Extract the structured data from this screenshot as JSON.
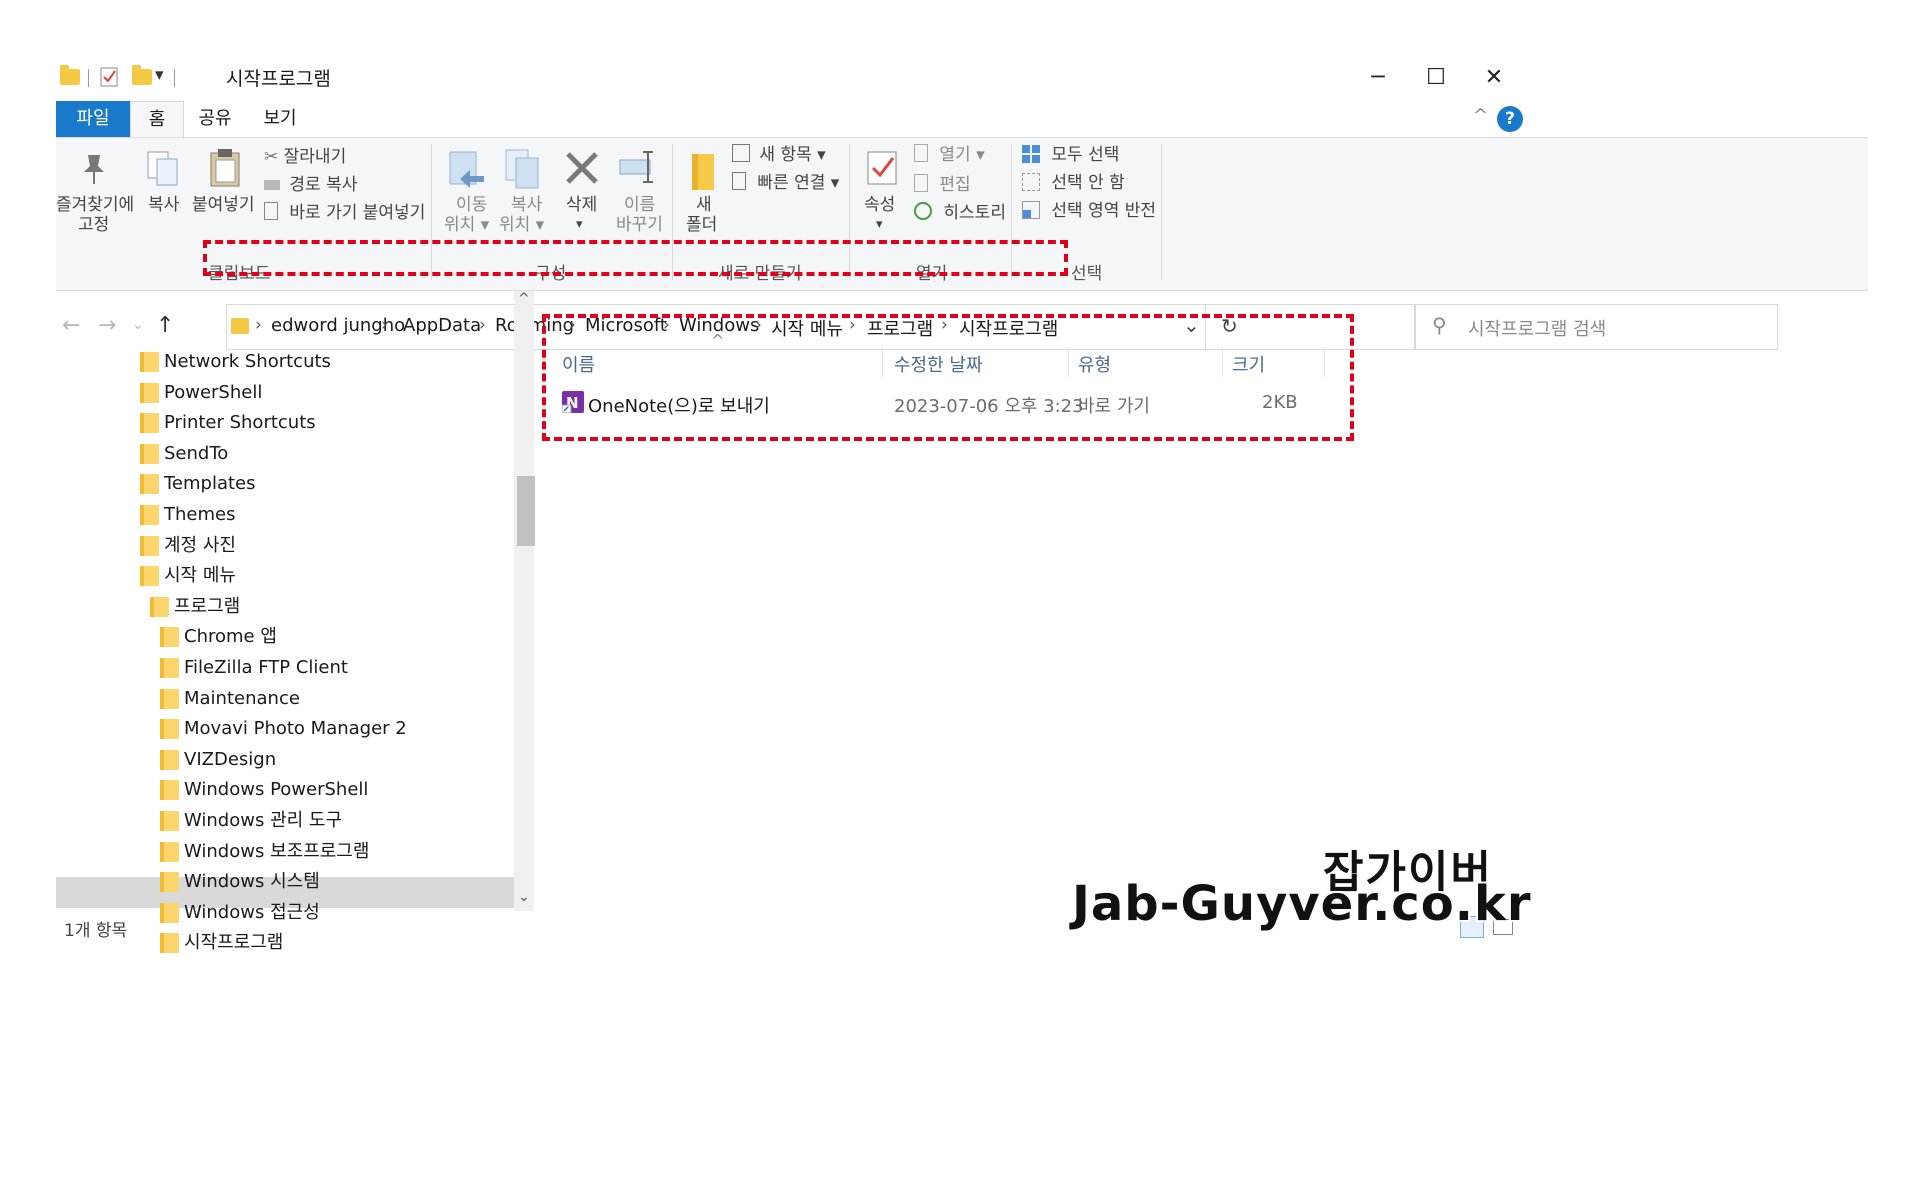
{
  "window": {
    "title": "시작프로그램",
    "controls": {
      "minimize": "─",
      "maximize": "☐",
      "close": "✕"
    }
  },
  "tabs": [
    {
      "label": "파일"
    },
    {
      "label": "홈"
    },
    {
      "label": "공유"
    },
    {
      "label": "보기"
    }
  ],
  "ribbon": {
    "clipboard": {
      "group": "클립보드",
      "pin_line1": "즐겨찾기에",
      "pin_line2": "고정",
      "copy": "복사",
      "paste": "붙여넣기",
      "cut": "잘라내기",
      "copy_path": "경로 복사",
      "paste_shortcut": "바로 가기 붙여넣기"
    },
    "organize": {
      "group": "구성",
      "move_line1": "이동",
      "move_line2": "위치 ▾",
      "copyto_line1": "복사",
      "copyto_line2": "위치 ▾",
      "delete": "삭제",
      "delete_arrow": "▾",
      "rename_line1": "이름",
      "rename_line2": "바꾸기"
    },
    "new": {
      "group": "새로 만들기",
      "new_folder_line1": "새",
      "new_folder_line2": "폴더",
      "new_item": "새 항목 ▾",
      "easy_access": "빠른 연결 ▾"
    },
    "open": {
      "group": "열기",
      "properties": "속성",
      "properties_arrow": "▾",
      "open": "열기 ▾",
      "edit": "편집",
      "history": "히스토리"
    },
    "select": {
      "group": "선택",
      "select_all": "모두 선택",
      "select_none": "선택 안 함",
      "invert": "선택 영역 반전"
    }
  },
  "address": {
    "breadcrumb": [
      "edword jungho",
      "AppData",
      "Roaming",
      "Microsoft",
      "Windows",
      "시작 메뉴",
      "프로그램",
      "시작프로그램"
    ],
    "search_placeholder": "시작프로그램 검색"
  },
  "tree": {
    "items": [
      {
        "label": "Network Shortcuts",
        "indent": 0
      },
      {
        "label": "PowerShell",
        "indent": 0
      },
      {
        "label": "Printer Shortcuts",
        "indent": 0
      },
      {
        "label": "SendTo",
        "indent": 0
      },
      {
        "label": "Templates",
        "indent": 0
      },
      {
        "label": "Themes",
        "indent": 0
      },
      {
        "label": "계정 사진",
        "indent": 0
      },
      {
        "label": "시작 메뉴",
        "indent": 0
      },
      {
        "label": "프로그램",
        "indent": 1
      },
      {
        "label": "Chrome 앱",
        "indent": 2
      },
      {
        "label": "FileZilla FTP Client",
        "indent": 2
      },
      {
        "label": "Maintenance",
        "indent": 2
      },
      {
        "label": "Movavi Photo Manager 2",
        "indent": 2
      },
      {
        "label": "VIZDesign",
        "indent": 2
      },
      {
        "label": "Windows PowerShell",
        "indent": 2
      },
      {
        "label": "Windows 관리 도구",
        "indent": 2
      },
      {
        "label": "Windows 보조프로그램",
        "indent": 2
      },
      {
        "label": "Windows 시스템",
        "indent": 2
      },
      {
        "label": "Windows 접근성",
        "indent": 2
      },
      {
        "label": "시작프로그램",
        "indent": 2
      }
    ]
  },
  "list": {
    "columns": {
      "name": "이름",
      "date": "수정한 날짜",
      "type": "유형",
      "size": "크기"
    },
    "rows": [
      {
        "name": "OneNote(으)로 보내기",
        "date": "2023-07-06 오후 3:23",
        "type": "바로 가기",
        "size": "2KB"
      }
    ]
  },
  "status": {
    "count": "1개 항목"
  },
  "watermark": {
    "line1": "잡가이버",
    "line2": "Jab-Guyver.co.kr"
  },
  "colors": {
    "accent": "#1979ca",
    "highlight": "#e0001a",
    "selection": "#d9d9d9"
  }
}
